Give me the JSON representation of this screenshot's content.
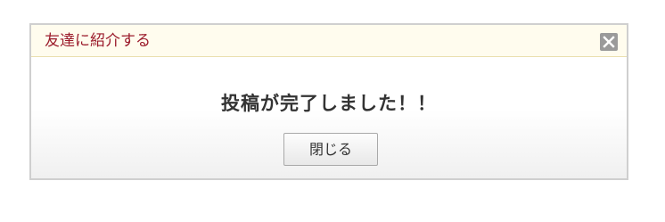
{
  "dialog": {
    "title": "友達に紹介する",
    "message": "投稿が完了しました！！",
    "close_button_label": "閉じる",
    "close_icon": "close-icon"
  },
  "colors": {
    "title_text": "#9b1b2b",
    "header_background": "#fffcee",
    "border": "#cfcfcf",
    "close_icon_background": "#9a9a9a"
  }
}
